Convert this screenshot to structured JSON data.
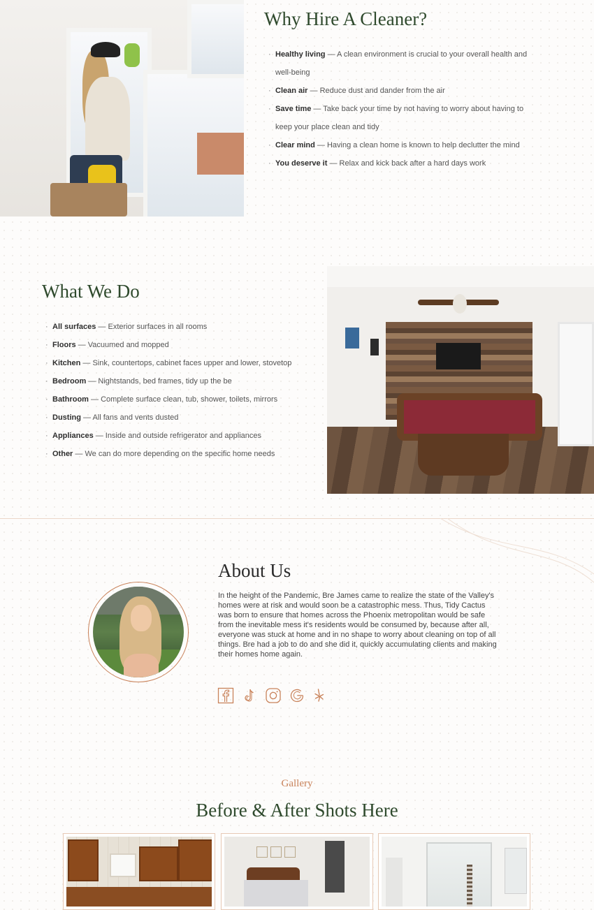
{
  "hire": {
    "title": "Why Hire A Cleaner?",
    "items": [
      {
        "term": "Healthy living",
        "text": " — A clean environment is crucial to your overall health and well-being"
      },
      {
        "term": "Clean air",
        "text": " — Reduce dust and dander from the air"
      },
      {
        "term": "Save time",
        "text": " — Take back your time by not having to worry about having to keep your place clean and tidy"
      },
      {
        "term": "Clear mind",
        "text": " — Having a clean home is known to help declutter the mind"
      },
      {
        "term": "You deserve it",
        "text": " — Relax and kick back after a hard days work"
      }
    ]
  },
  "what_we_do": {
    "title": "What We Do",
    "items": [
      {
        "term": "All surfaces",
        "text": " — Exterior surfaces in all rooms"
      },
      {
        "term": "Floors",
        "text": " — Vacuumed and mopped"
      },
      {
        "term": "Kitchen",
        "text": " — Sink, countertops, cabinet faces upper and lower, stovetop"
      },
      {
        "term": "Bedroom",
        "text": " — Nightstands, bed frames, tidy up the be"
      },
      {
        "term": "Bathroom",
        "text": " — Complete surface clean, tub, shower, toilets, mirrors"
      },
      {
        "term": "Dusting",
        "text": " — All fans and vents dusted"
      },
      {
        "term": "Appliances",
        "text": " — Inside and outside refrigerator and appliances"
      },
      {
        "term": "Other",
        "text": " — We can do more depending on the specific home needs"
      }
    ]
  },
  "about": {
    "title": "About Us",
    "body": "In the height of the Pandemic, Bre James came to realize the state of the Valley's homes were at risk and would soon be a catastrophic mess. Thus, Tidy Cactus was born to ensure that homes across the Phoenix metropolitan would be safe from the inevitable mess it's residents would be consumed by, because after all, everyone was stuck at home and in no shape to worry about cleaning on top of all things. Bre had a job to do and she did it, quickly accumulating clients and making their homes home again.",
    "social_icons": [
      "facebook-icon",
      "tiktok-icon",
      "instagram-icon",
      "google-icon",
      "yelp-icon"
    ]
  },
  "gallery": {
    "kicker": "Gallery",
    "title": "Before & After Shots Here"
  },
  "colors": {
    "heading_green": "#2f4a2d",
    "accent_copper": "#c9835b",
    "body_text": "#555555"
  }
}
